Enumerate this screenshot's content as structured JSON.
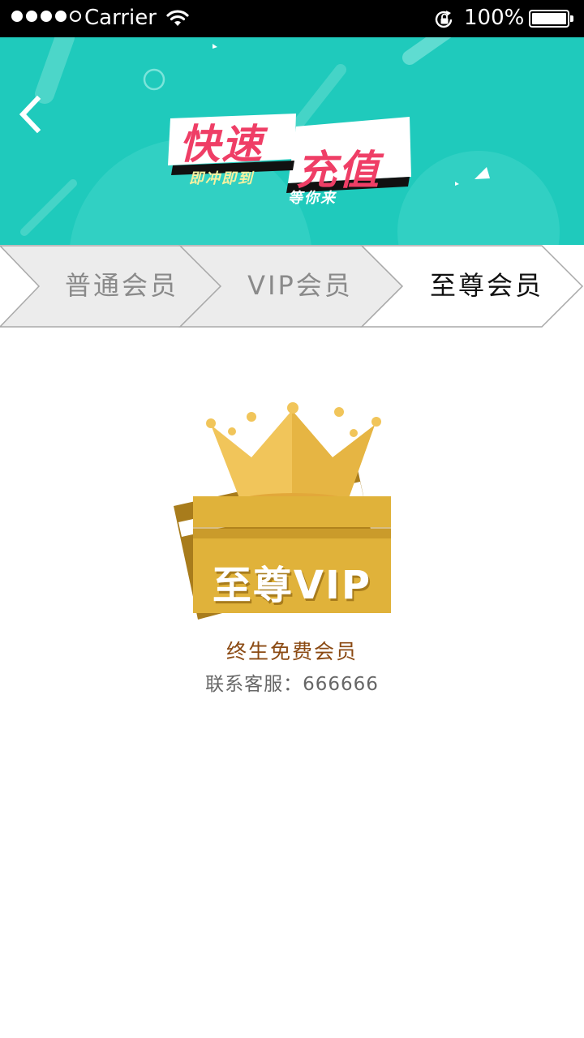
{
  "status_bar": {
    "carrier": "Carrier",
    "battery": "100%"
  },
  "banner": {
    "title_line1": "快速",
    "title_line2": "充值",
    "slogan1": "即冲即到",
    "slogan2": "等你来"
  },
  "tabs": [
    {
      "label": "普通会员",
      "selected": false
    },
    {
      "label": "VIP会员",
      "selected": false
    },
    {
      "label": "至尊会员",
      "selected": true
    }
  ],
  "membership": {
    "card_text": "至尊VIP",
    "description": "终生免费会员",
    "contact": "联系客服：666666"
  },
  "colors": {
    "banner_bg": "#1fcabc",
    "title_red": "#ef3e66",
    "card_gold": "#e0b23a",
    "description_brown": "#8b4a13"
  },
  "icons": {
    "back": "chevron-left-icon",
    "wifi": "wifi-icon",
    "lock": "rotation-lock-icon",
    "battery": "battery-icon"
  }
}
